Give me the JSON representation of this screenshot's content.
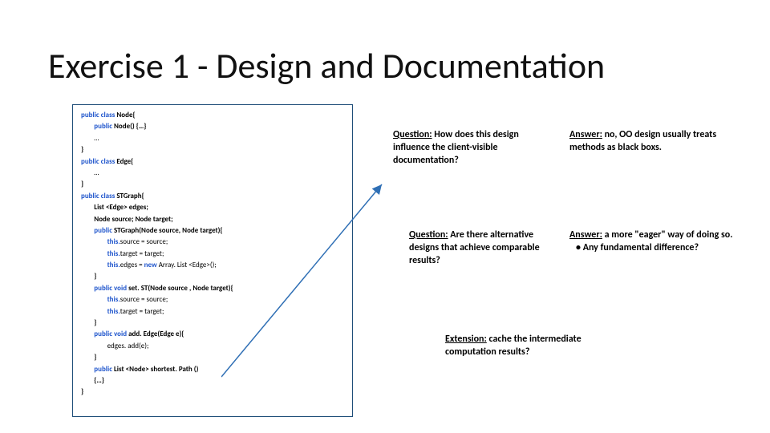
{
  "title": "Exercise 1 - Design and Documentation",
  "code": {
    "l1a": "public class ",
    "l1b": "Node{",
    "l2a": "public ",
    "l2b": "Node() {…}",
    "l3": "…",
    "l4": "}",
    "l5a": "public class ",
    "l5b": "Edge{",
    "l6": "…",
    "l7": "}",
    "l8a": "public class ",
    "l8b": "STGraph{",
    "l9": "List <Edge> edges;",
    "l10": "Node source; Node target;",
    "l11a": "public ",
    "l11b": "STGraph(Node source, Node target){",
    "l12a": "this.",
    "l12b": "source = source;",
    "l13a": "this.",
    "l13b": "target = target;",
    "l14a": "this.",
    "l14b": "edges = ",
    "l14c": "new ",
    "l14d": "Array. List <Edge>();",
    "l15": "}",
    "l16a": "public void ",
    "l16b": "set. ST(Node source , Node target){",
    "l17a": "this.",
    "l17b": "source = source;",
    "l18a": "this.",
    "l18b": "target = target;",
    "l19": "}",
    "l20a": "public void ",
    "l20b": "add. Edge(Edge e){",
    "l21": "edges. add(e);",
    "l22": "}",
    "l23a": "public ",
    "l23b": "List <Node> shortest. Path ()",
    "l24": "{…}",
    "l25": "}"
  },
  "q1": {
    "hdr": "Question:",
    "txt": " How does this design influence the client-visible documentation?"
  },
  "a1": {
    "hdr": "Answer:",
    "txt": " no, OO design usually treats methods as black boxs."
  },
  "q2": {
    "hdr": "Question:",
    "txt": " Are there alternative designs that achieve comparable results?"
  },
  "a2": {
    "hdr": "Answer:",
    "txt1": " a more \"eager\" way of doing so.",
    "bullet": "• Any fundamental difference?"
  },
  "ext": {
    "hdr": "Extension:",
    "txt": " cache the intermediate computation results?"
  }
}
